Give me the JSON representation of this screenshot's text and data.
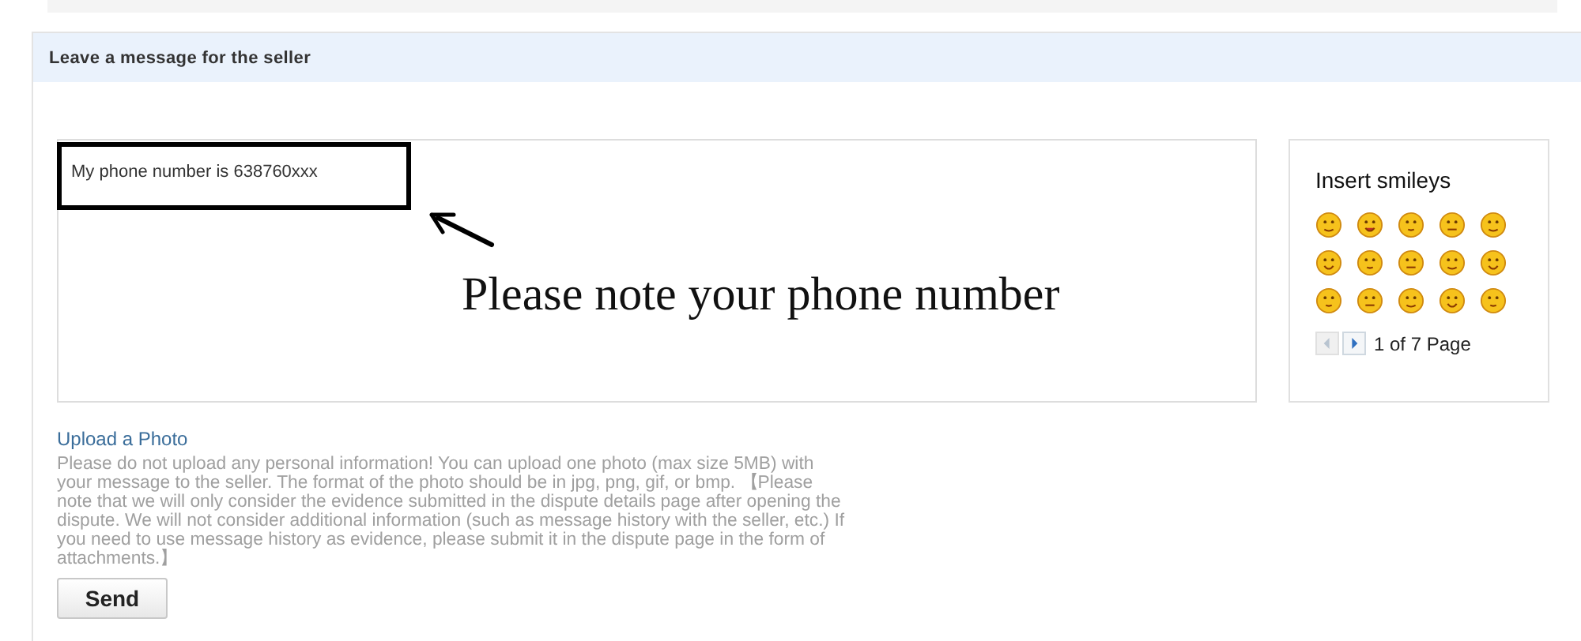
{
  "header": {
    "title": "Leave a message for the seller"
  },
  "message": {
    "value": "My phone number is 638760xxx"
  },
  "annotation": {
    "note": "Please note your phone number"
  },
  "smileys": {
    "title": "Insert smileys",
    "pager": {
      "text": "1 of 7 Page",
      "buttons": [
        {
          "kind": "prev",
          "disabled": true
        },
        {
          "kind": "next",
          "disabled": false
        }
      ]
    }
  },
  "upload": {
    "link": "Upload a Photo",
    "notice": "Please do not upload any personal information! You can upload one photo (max size 5MB) with your message to the seller. The format of the photo should be in jpg, png, gif, or bmp. 【Please note that we will only consider the evidence submitted in the dispute details page after opening the dispute. We will not consider additional information (such as message history with the seller, etc.) If you need to use message history as evidence, please submit it in the dispute page in the form of attachments.】"
  },
  "send_button": "Send"
}
